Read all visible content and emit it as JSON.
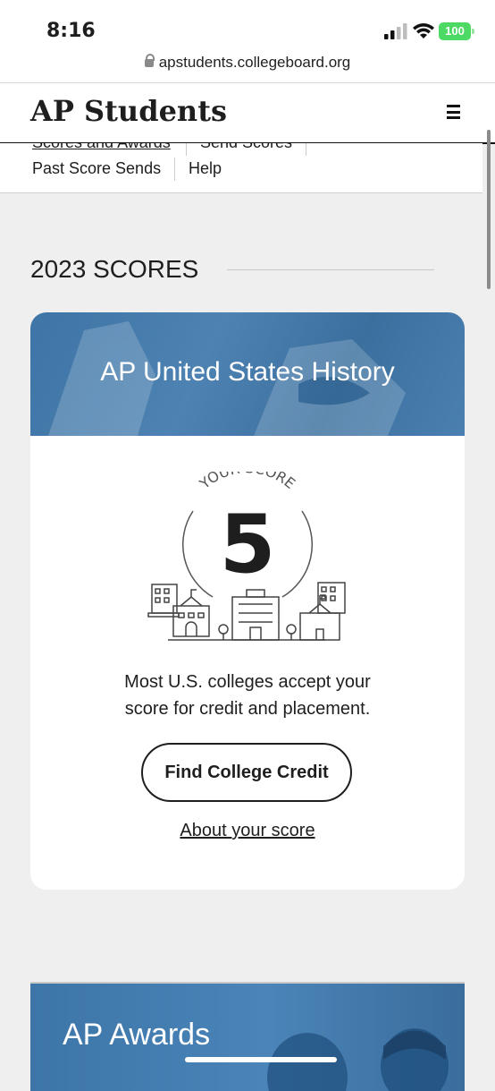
{
  "status_bar": {
    "time": "8:16",
    "battery": "100"
  },
  "browser": {
    "url": "apstudents.collegeboard.org"
  },
  "header": {
    "brand": "AP Students"
  },
  "subnav": {
    "row1": [
      "Scores and Awards",
      "Send Scores"
    ],
    "row2": [
      "Past Score Sends",
      "Help"
    ]
  },
  "section": {
    "title": "2023 SCORES"
  },
  "score_card": {
    "course": "AP United States History",
    "score_label": "YOUR SCORE",
    "score": "5",
    "description_line1": "Most U.S. colleges accept your",
    "description_line2": "score for credit and placement.",
    "cta": "Find College Credit",
    "link": "About your score"
  },
  "awards": {
    "title": "AP Awards"
  },
  "colors": {
    "hero_blue": "#3e75a6",
    "battery_green": "#4cd964"
  }
}
